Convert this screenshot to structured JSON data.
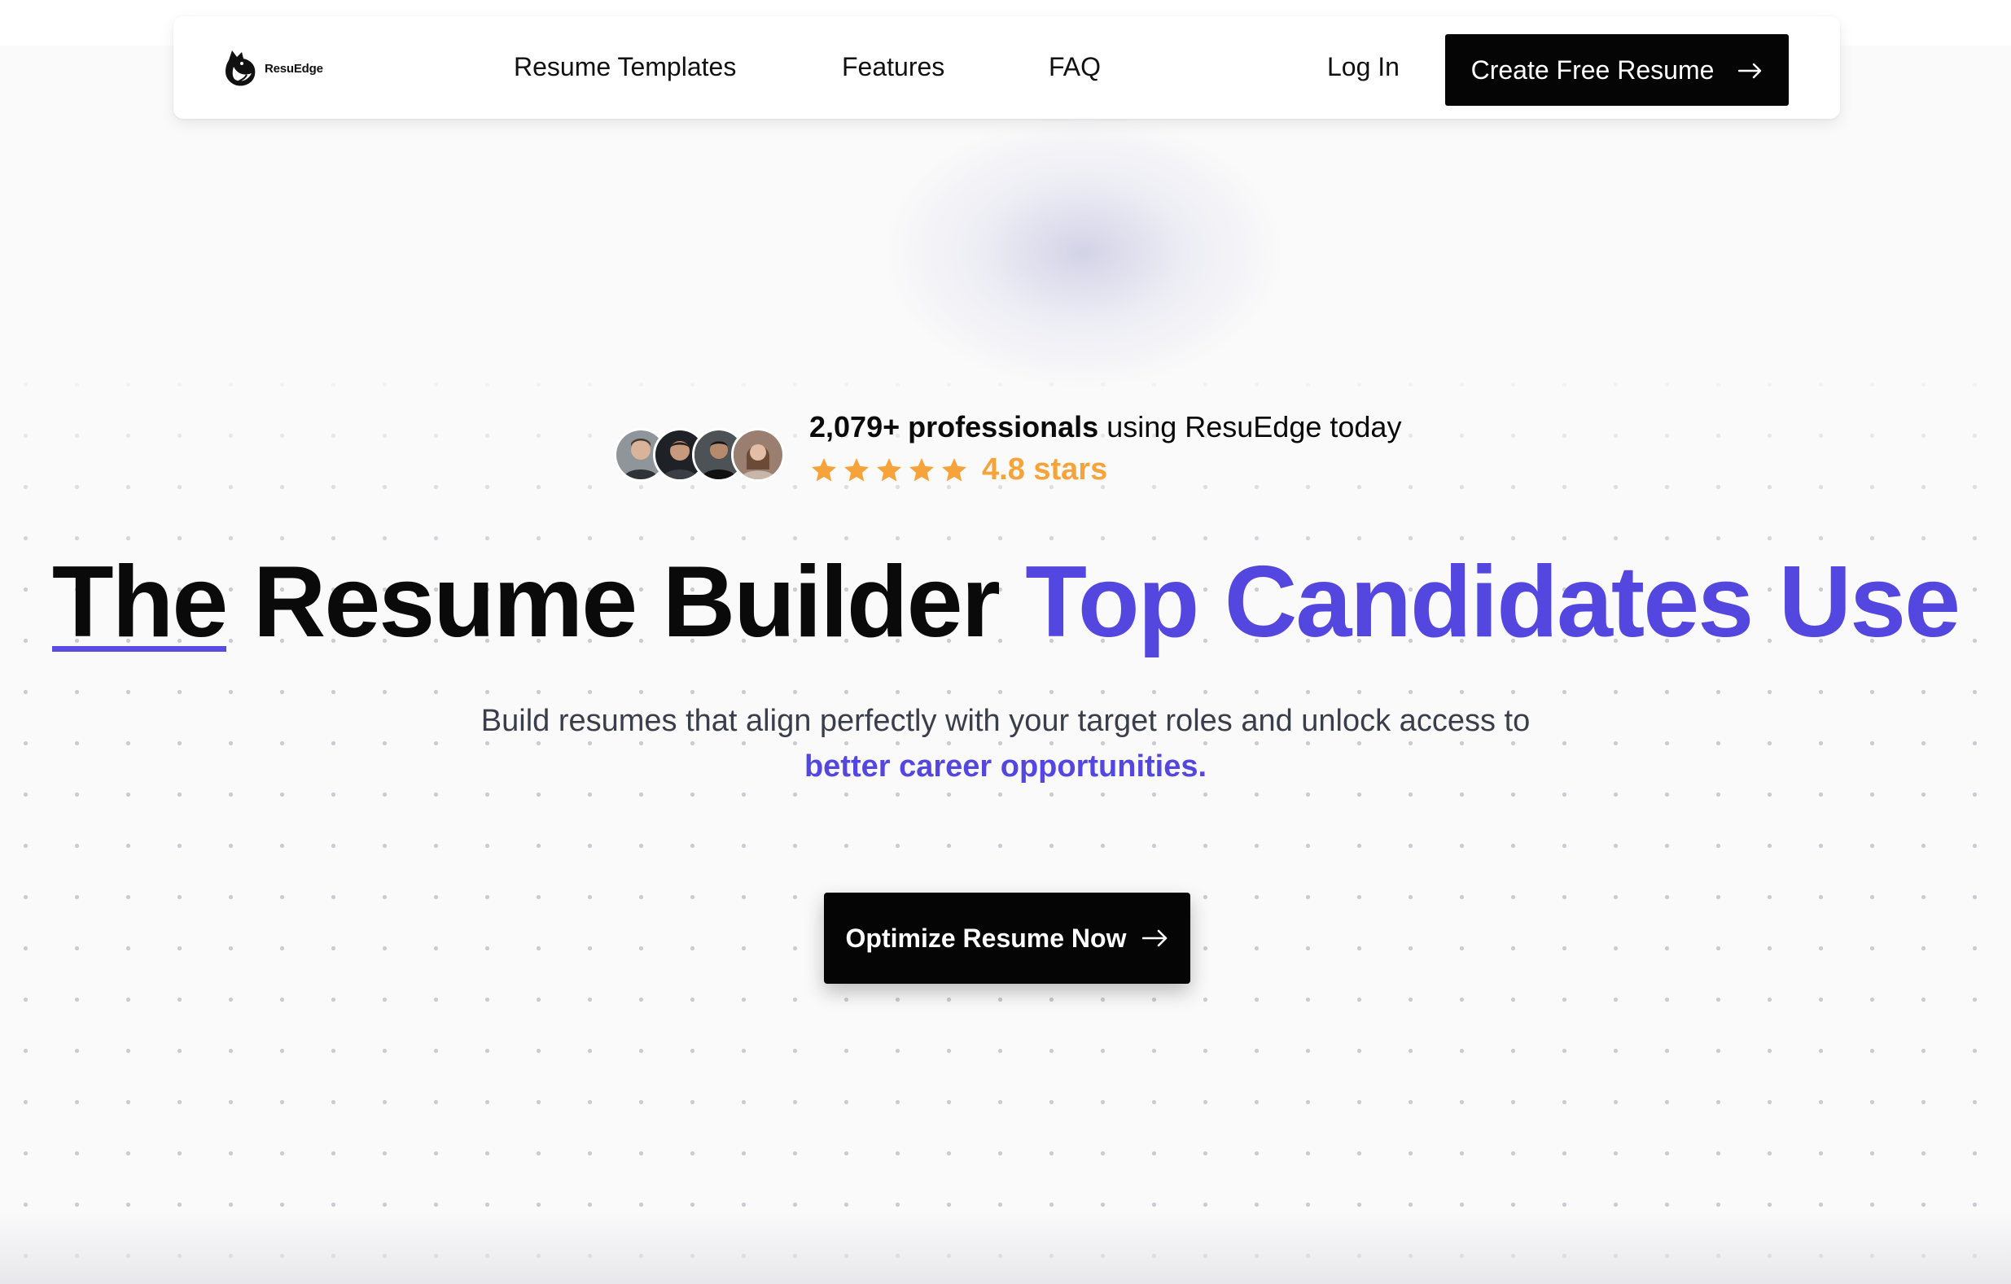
{
  "brand": {
    "name": "ResuEdge",
    "logo_icon": "wolf-logo-icon"
  },
  "nav": {
    "links": [
      {
        "label": "Resume Templates"
      },
      {
        "label": "Features"
      },
      {
        "label": "FAQ"
      }
    ],
    "login_label": "Log In",
    "cta_label": "Create Free Resume",
    "cta_icon": "arrow-right-icon"
  },
  "social_proof": {
    "count_text": "2,079+ professionals",
    "suffix_text": " using ResuEdge today",
    "rating_text": "4.8 stars",
    "stars": 5,
    "star_color": "#f5a33a",
    "avatars": [
      "avatar-1",
      "avatar-2",
      "avatar-3",
      "avatar-4"
    ]
  },
  "hero": {
    "headline_word_underlined": "The",
    "headline_plain": " Resume Builder ",
    "headline_accent": "Top Candidates Use",
    "subtext": "Build resumes that align perfectly with your target roles and unlock access to",
    "subtext_accent": "better career opportunities.",
    "cta_label": "Optimize Resume Now",
    "cta_icon": "arrow-right-icon"
  },
  "colors": {
    "accent": "#5447e0",
    "button_bg": "#050505",
    "background": "#fafafa"
  }
}
